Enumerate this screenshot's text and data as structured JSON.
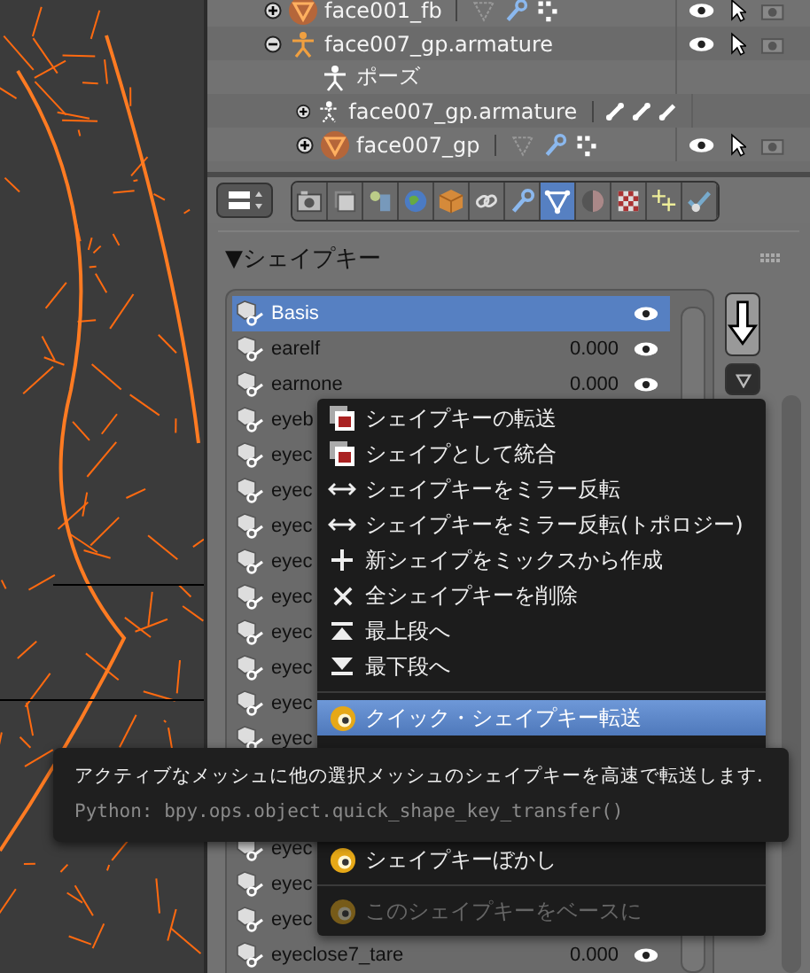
{
  "outliner": {
    "rows": [
      {
        "name": "face001_fb",
        "kind": "mesh",
        "expanded": false
      },
      {
        "name": "face007_gp.armature",
        "kind": "armature",
        "expanded": true,
        "children": [
          {
            "name": "ポーズ",
            "kind": "pose"
          },
          {
            "name": "face007_gp.armature",
            "kind": "armature-data",
            "expanded": false
          },
          {
            "name": "face007_gp",
            "kind": "mesh",
            "expanded": false
          }
        ]
      }
    ]
  },
  "properties": {
    "tabs": [
      {
        "kind": "camera",
        "selected": false
      },
      {
        "kind": "layers",
        "selected": false
      },
      {
        "kind": "scene",
        "selected": false
      },
      {
        "kind": "world",
        "selected": false
      },
      {
        "kind": "object",
        "selected": false
      },
      {
        "kind": "constraint",
        "selected": false
      },
      {
        "kind": "modifier",
        "selected": false
      },
      {
        "kind": "data",
        "selected": true
      },
      {
        "kind": "material",
        "selected": false
      },
      {
        "kind": "texture",
        "selected": false
      },
      {
        "kind": "particles",
        "selected": false
      },
      {
        "kind": "physics",
        "selected": false
      }
    ],
    "panel": {
      "title": "▼シェイプキー"
    },
    "shape_keys": {
      "items": [
        {
          "name": "Basis",
          "selected": true
        },
        {
          "name": "earelf",
          "value": "0.000",
          "selected": false
        },
        {
          "name": "earnone",
          "value": "0.000",
          "selected": false
        },
        {
          "name": "eyeb",
          "selected": false
        },
        {
          "name": "eyec",
          "selected": false
        },
        {
          "name": "eyec",
          "selected": false
        },
        {
          "name": "eyec",
          "selected": false
        },
        {
          "name": "eyec",
          "selected": false
        },
        {
          "name": "eyec",
          "selected": false
        },
        {
          "name": "eyec",
          "selected": false
        },
        {
          "name": "eyec",
          "selected": false
        },
        {
          "name": "eyec",
          "selected": false
        },
        {
          "name": "eyec",
          "selected": false
        }
      ],
      "items_below": [
        {
          "name": "eyec",
          "selected": false
        },
        {
          "name": "eyec",
          "selected": false
        },
        {
          "name": "eyec",
          "selected": false
        },
        {
          "name": "eyeclose7_tare",
          "value": "0.000",
          "selected": false
        }
      ]
    }
  },
  "context_menu": {
    "items": [
      {
        "kind": "id",
        "label": "シェイプキーの転送",
        "selected": false,
        "disabled": false
      },
      {
        "kind": "id",
        "label": "シェイプとして統合",
        "selected": false,
        "disabled": false
      },
      {
        "kind": "mirror",
        "label": "シェイプキーをミラー反転",
        "selected": false,
        "disabled": false
      },
      {
        "kind": "mirror",
        "label": "シェイプキーをミラー反転(トポロジー)",
        "selected": false,
        "disabled": false
      },
      {
        "kind": "plus",
        "label": "新シェイプをミックスから作成",
        "selected": false,
        "disabled": false
      },
      {
        "kind": "cross",
        "label": "全シェイプキーを削除",
        "selected": false,
        "disabled": false
      },
      {
        "kind": "top",
        "label": "最上段へ",
        "selected": false,
        "disabled": false
      },
      {
        "kind": "bottom",
        "label": "最下段へ",
        "selected": false,
        "disabled": false
      },
      {
        "kind": "separator"
      },
      {
        "kind": "addon",
        "label": "クイック・シェイプキー転送",
        "selected": true,
        "disabled": false
      }
    ],
    "items_below": [
      {
        "kind": "addon",
        "label": "シェイプキーぼかし",
        "selected": false,
        "disabled": false
      },
      {
        "kind": "separator"
      },
      {
        "kind": "addon",
        "label": "このシェイプキーをベースに",
        "selected": false,
        "disabled": true
      }
    ]
  },
  "tooltip": {
    "description": "アクティブなメッシュに他の選択メッシュのシェイプキーを高速で転送します.",
    "python": "Python: bpy.ops.object.quick_shape_key_transfer()"
  }
}
